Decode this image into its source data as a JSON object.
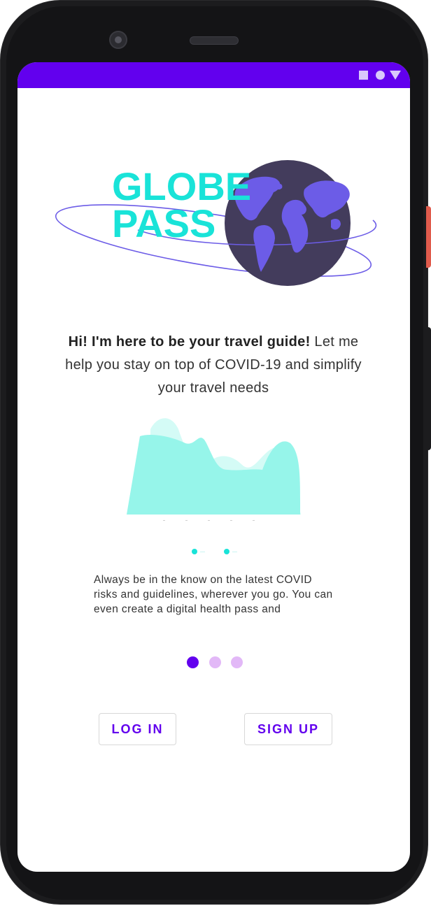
{
  "app": {
    "logo_line1": "GLOBE",
    "logo_line2": "PASS"
  },
  "status_bar": {
    "icons": [
      "square-icon",
      "circle-icon",
      "triangle-icon"
    ]
  },
  "tagline": {
    "bold": "Hi! I'm here to be your travel guide!",
    "rest": " Let me help you stay on top of COVID-19 and simplify your travel needs"
  },
  "carousel": {
    "description": "Always be in the know on the latest COVID risks and guidelines, wherever you go. You can even create a digital health pass and",
    "page_count": 3,
    "active_page": 1
  },
  "actions": {
    "login_label": "LOG IN",
    "signup_label": "SIGN UP"
  },
  "colors": {
    "accent": "#6200ee",
    "logo_text": "#19e3d8",
    "globe": "#433c5c",
    "continents": "#6c5ce7",
    "orbit": "#6c5ce7",
    "chart_fill": "#96f5ea",
    "page_dot_inactive": "#e2b8f7"
  }
}
